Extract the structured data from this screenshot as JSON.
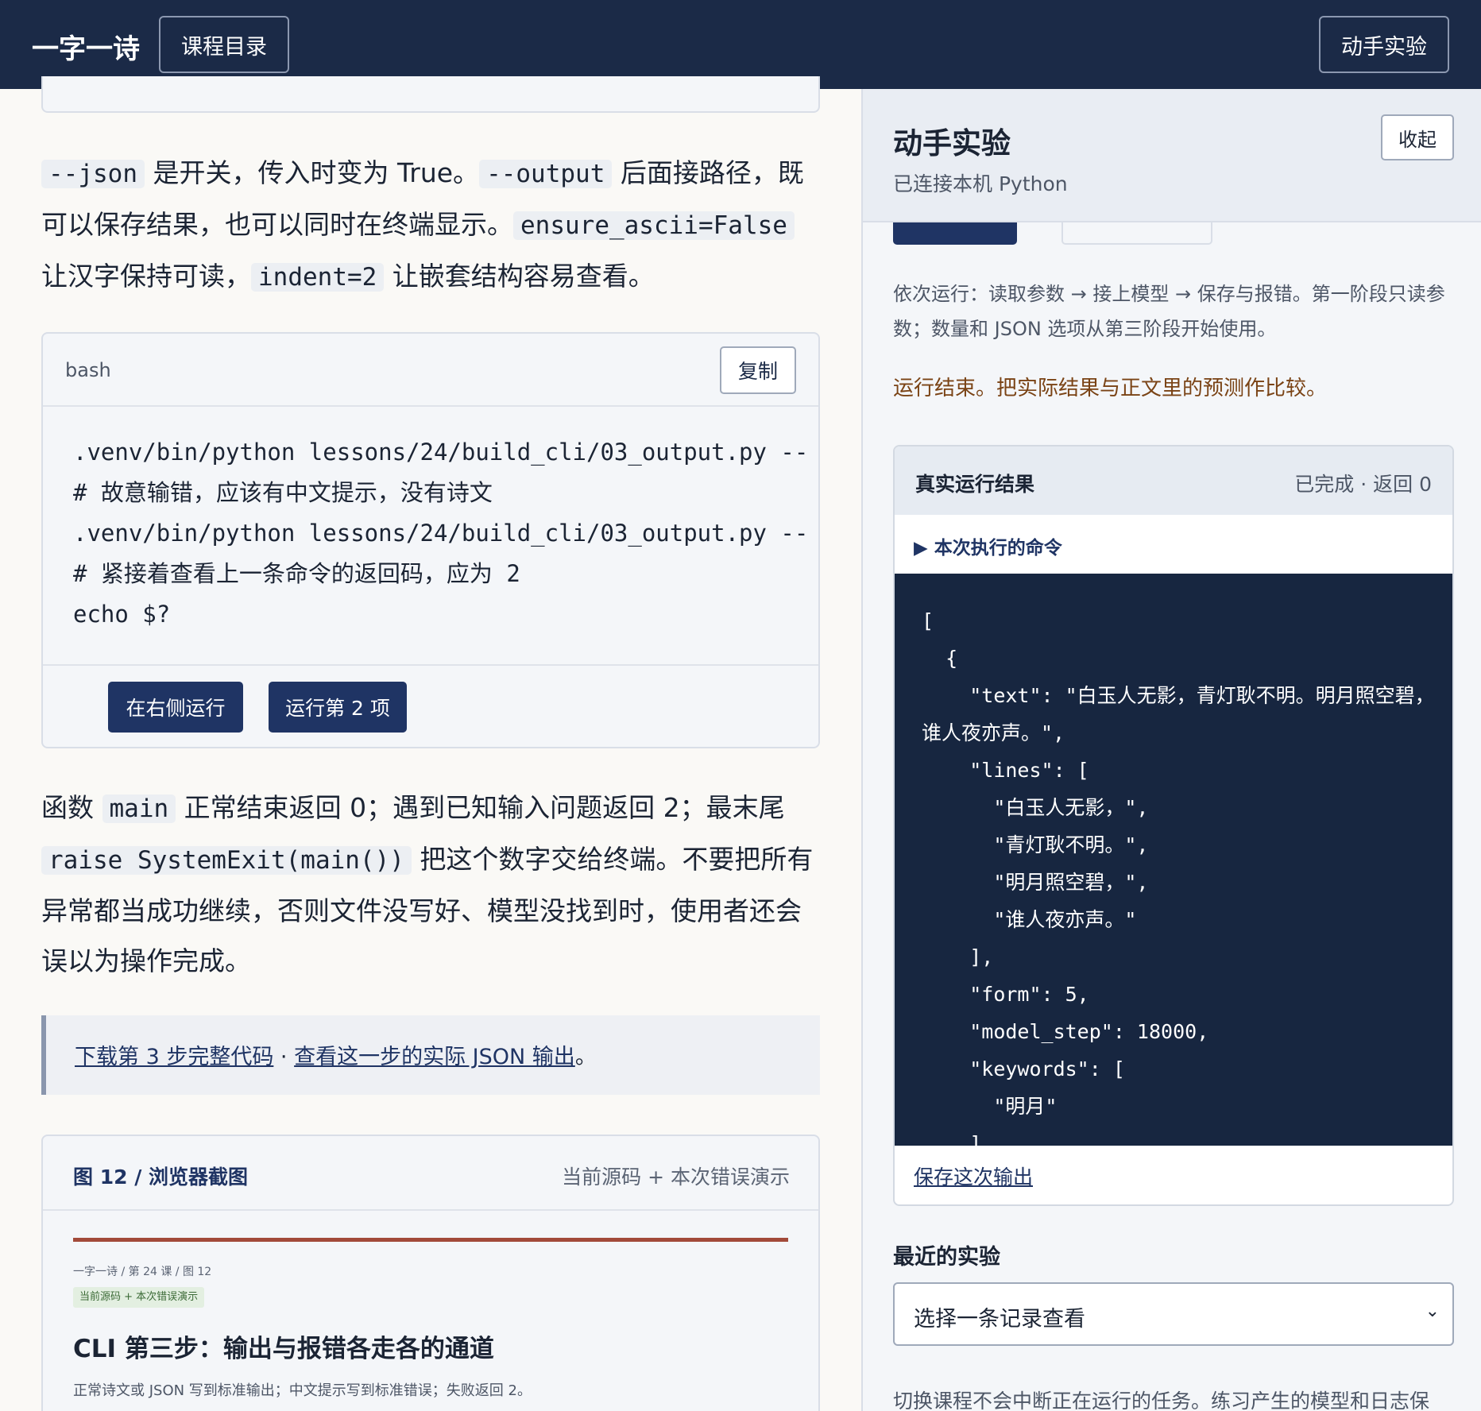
{
  "topbar": {
    "brand": "一字一诗",
    "catalog_label": "课程目录",
    "lab_label": "动手实验"
  },
  "para1": {
    "t1": "--json",
    "t2": " 是开关，传入时变为 True。",
    "t3": "--output",
    "t4": " 后面接路径，既可以保存结果，也可以同时在终端显示。",
    "t5": "ensure_ascii=False",
    "t6": " 让汉字保持可读，",
    "t7": "indent=2",
    "t8": " 让嵌套结构容易查看。"
  },
  "codeblock": {
    "lang": "bash",
    "copy_label": "复制",
    "lines": [
      ".venv/bin/python lessons/24/build_cli/03_output.py --",
      "# 故意输错，应该有中文提示，没有诗文",
      ".venv/bin/python lessons/24/build_cli/03_output.py --",
      "# 紧接着查看上一条命令的返回码，应为 2",
      "echo $?"
    ],
    "run_right_label": "在右侧运行",
    "run_item_label": "运行第 2 项"
  },
  "para2": {
    "t1": "函数 ",
    "t2": "main",
    "t3": " 正常结束返回 0；遇到已知输入问题返回 2；最末尾 ",
    "t4": "raise SystemExit(main())",
    "t5": " 把这个数字交给终端。不要把所有异常都当成功继续，否则文件没写好、模型没找到时，使用者还会误以为操作完成。"
  },
  "note": {
    "link1": "下载第 3 步完整代码",
    "sep": " · ",
    "link2": "查看这一步的实际 JSON 输出",
    "end": "。"
  },
  "figure": {
    "title": "图 12 / 浏览器截图",
    "caption": "当前源码 + 本次错误演示",
    "crumb": "一字一诗 / 第 24 课 / 图 12",
    "badge": "当前源码 + 本次错误演示",
    "heading": "CLI 第三步：输出与报错各走各的通道",
    "sub": "正常诗文或 JSON 写到标准输出；中文提示写到标准错误；失败返回 2。"
  },
  "panel": {
    "title": "动手实验",
    "subtitle": "已连接本机 Python",
    "collapse_label": "收起",
    "desc": "依次运行：读取参数 → 接上模型 → 保存与报错。第一阶段只读参数；数量和 JSON 选项从第三阶段开始使用。",
    "status": "运行结束。把实际结果与正文里的预测作比较。",
    "result": {
      "title": "真实运行结果",
      "state": "已完成 · 返回 0",
      "cmd_toggle": "▶ 本次执行的命令",
      "output": "[\n  {\n    \"text\": \"白玉人无影，青灯耿不明。明月照空碧，谁人夜亦声。\",\n    \"lines\": [\n      \"白玉人无影，\",\n      \"青灯耿不明。\",\n      \"明月照空碧，\",\n      \"谁人夜亦声。\"\n    ],\n    \"form\": 5,\n    \"model_step\": 18000,\n    \"keywords\": [\n      \"明月\"\n    ],",
      "save_label": "保存这次输出"
    },
    "recent_title": "最近的实验",
    "select_placeholder": "选择一条记录查看",
    "footer": "切换课程不会中断正在运行的任务。练习产生的模型和日志保"
  }
}
